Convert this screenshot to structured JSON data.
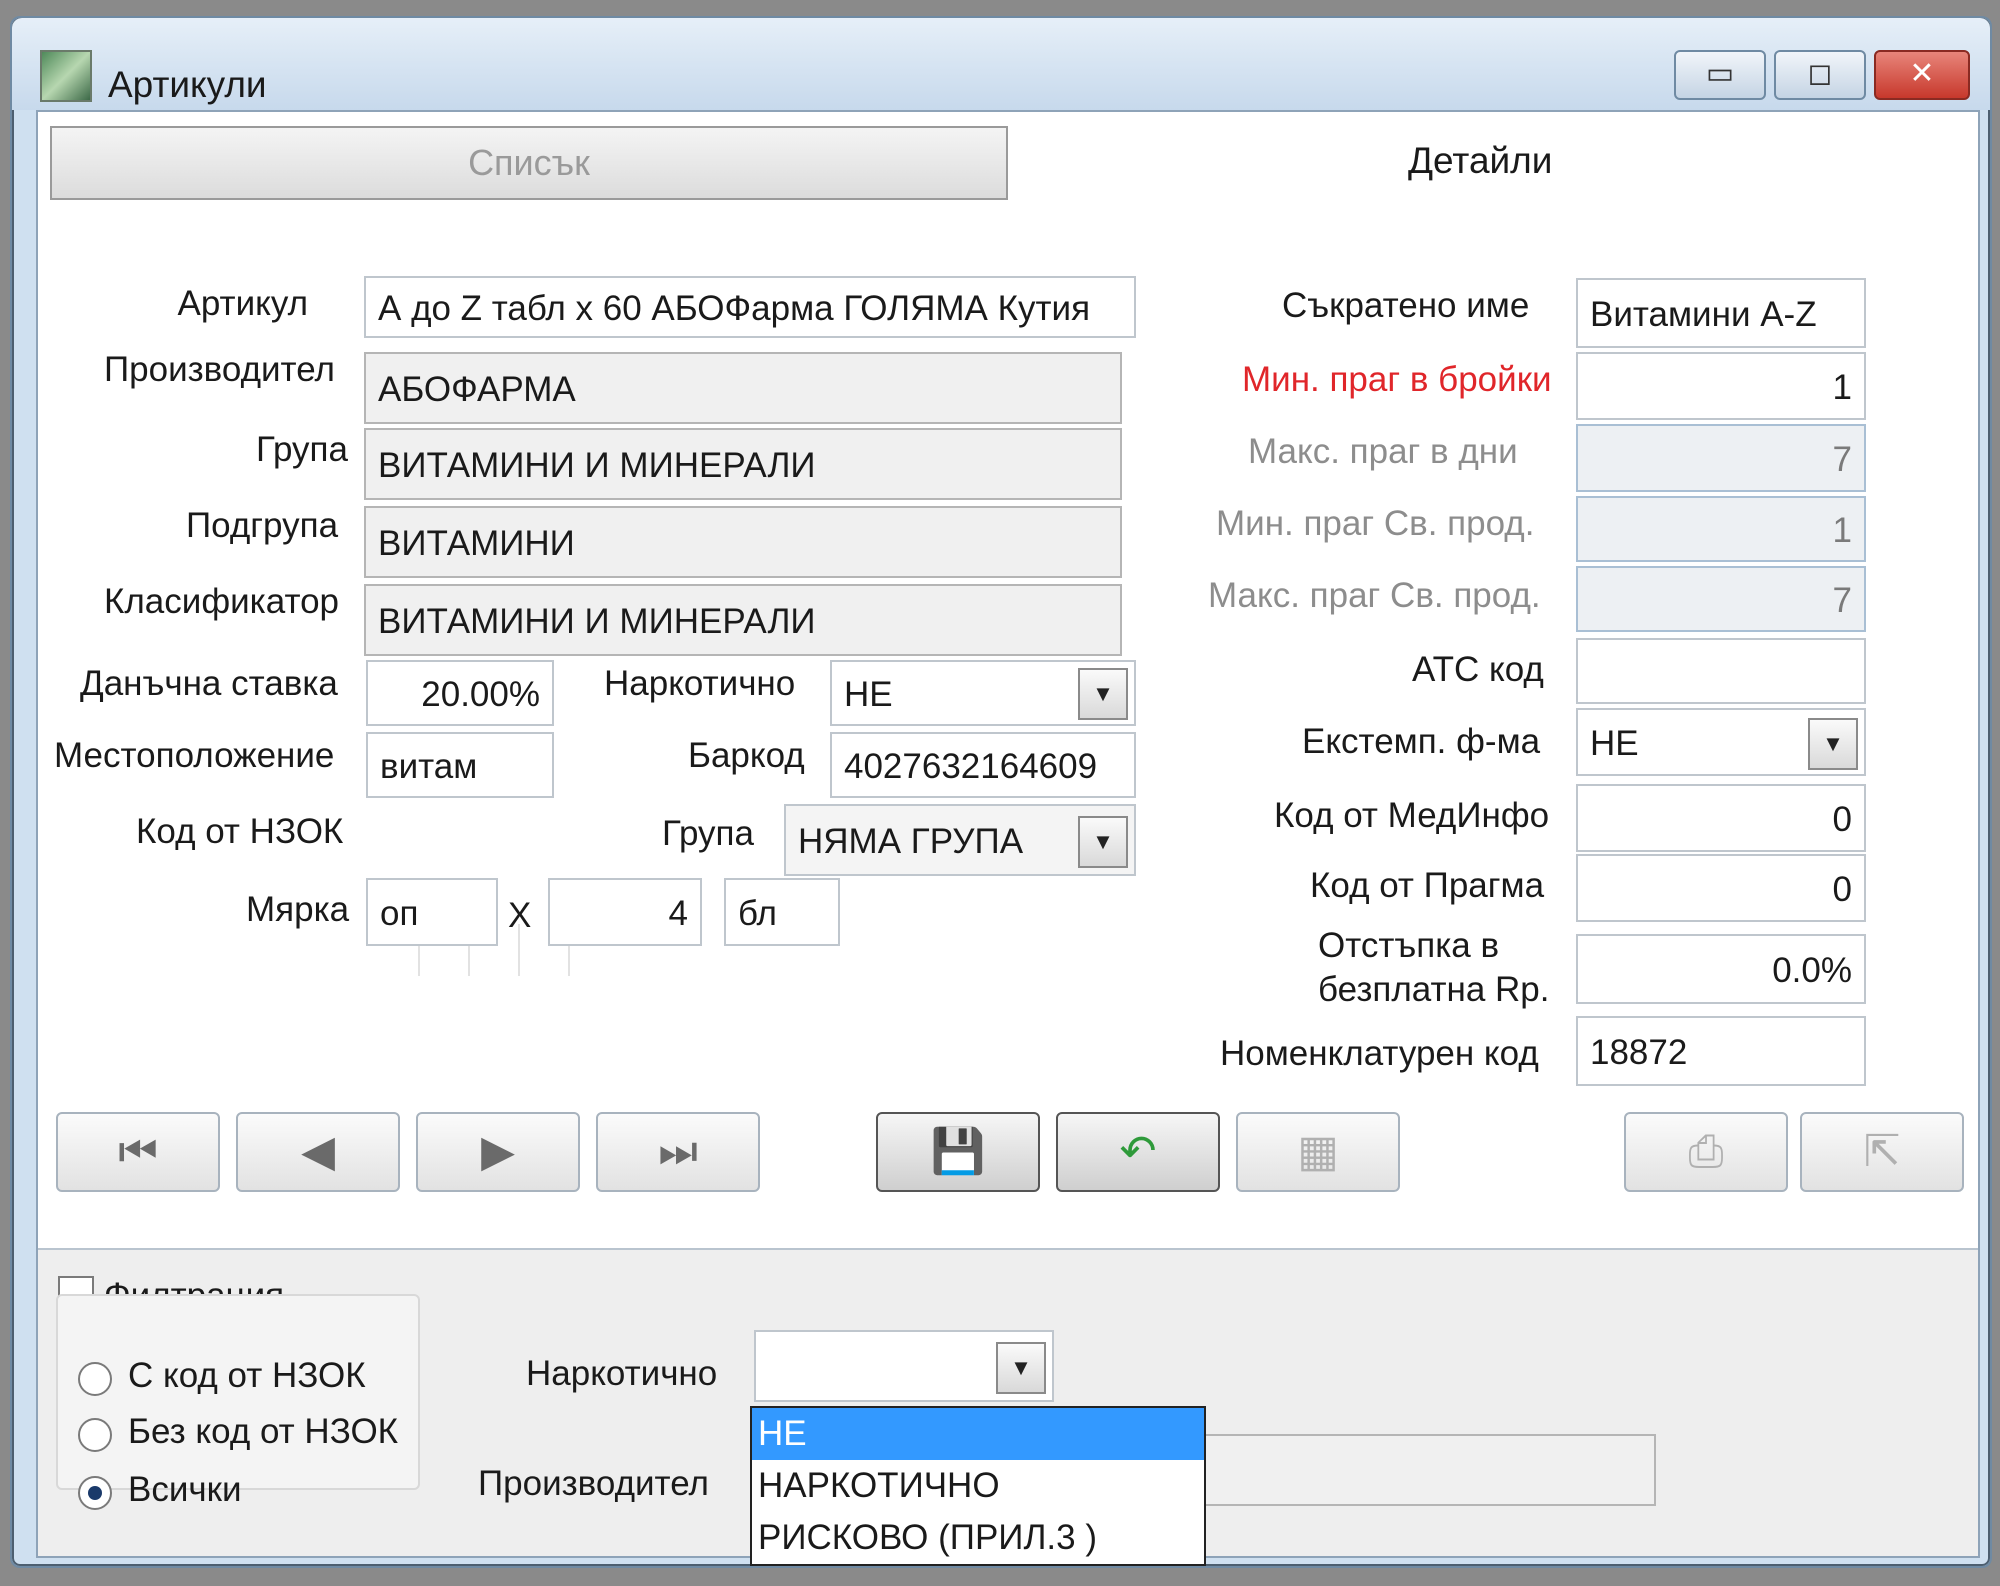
{
  "window": {
    "title": "Артикули",
    "controls": {
      "minimize": "▭",
      "maximize": "◻",
      "close": "✕"
    }
  },
  "tabs": {
    "list": "Списък",
    "details": "Детайли"
  },
  "left": {
    "article_label": "Артикул",
    "article_value": "А до Z  табл x 60 АБОФарма  ГОЛЯМА Кутия",
    "manufacturer_label": "Производител",
    "manufacturer_value": "АБОФАРМА",
    "group_label": "Група",
    "group_value": "ВИТАМИНИ И МИНЕРАЛИ",
    "subgroup_label": "Подгрупа",
    "subgroup_value": "ВИТАМИНИ",
    "classifier_label": "Класификатор",
    "classifier_value": "ВИТАМИНИ И МИНЕРАЛИ",
    "tax_label": "Данъчна ставка",
    "tax_value": "20.00%",
    "narcotic_label": "Наркотично",
    "narcotic_value": "НЕ",
    "location_label": "Местоположение",
    "location_value": "витам",
    "barcode_label": "Баркод",
    "barcode_value": "4027632164609",
    "nhif_label": "Код от НЗОК",
    "group2_label": "Група",
    "group2_value": "НЯМА ГРУПА",
    "measure_label": "Мярка",
    "measure_unit": "оп",
    "measure_x": "X",
    "measure_qty": "4",
    "measure_subunit": "бл"
  },
  "right": {
    "short_name_label": "Съкратено име",
    "short_name_value": "Витамини A-Z",
    "min_pcs_label": "Мин. праг в бройки",
    "min_pcs_value": "1",
    "max_days_label": "Макс. праг в дни",
    "max_days_value": "7",
    "min_free_label": "Мин. праг Св. прод.",
    "min_free_value": "1",
    "max_free_label": "Макс. праг Св. прод.",
    "max_free_value": "7",
    "atc_label": "АТС код",
    "atc_value": "",
    "extemp_label": "Екстемп. ф-ма",
    "extemp_value": "НЕ",
    "medinfo_label": "Код от МедИнфо",
    "medinfo_value": "0",
    "pragma_label": "Код от Прагма",
    "pragma_value": "0",
    "discount_label_1": "Отстъпка в",
    "discount_label_2": "безплатна Rp.",
    "discount_value": "0.0%",
    "nomenclature_label": "Номенклатурен код",
    "nomenclature_value": "18872"
  },
  "toolbar": {
    "first": "⏮",
    "prev": "◀",
    "next": "▶",
    "last": "⏭",
    "save": "💾",
    "undo": "↶",
    "delete": "▦",
    "print": "⎙",
    "export": "⇱"
  },
  "filter": {
    "title": "Филтрация",
    "checked": false,
    "radio_with_nhif": "С код от НЗОК",
    "radio_without_nhif": "Без код от НЗОК",
    "radio_all": "Всички",
    "selected_radio": "all",
    "narcotic_label": "Наркотично",
    "narcotic_value": "",
    "manufacturer_label": "Производител",
    "narcotic_options": [
      "НЕ",
      "НАРКОТИЧНО",
      "РИСКОВО (ПРИЛ.3 )"
    ],
    "highlighted_option": "НЕ"
  },
  "colors": {
    "accent": "#3399ff",
    "required_label": "#e0262a",
    "window_frame": "#cfe0f0"
  }
}
